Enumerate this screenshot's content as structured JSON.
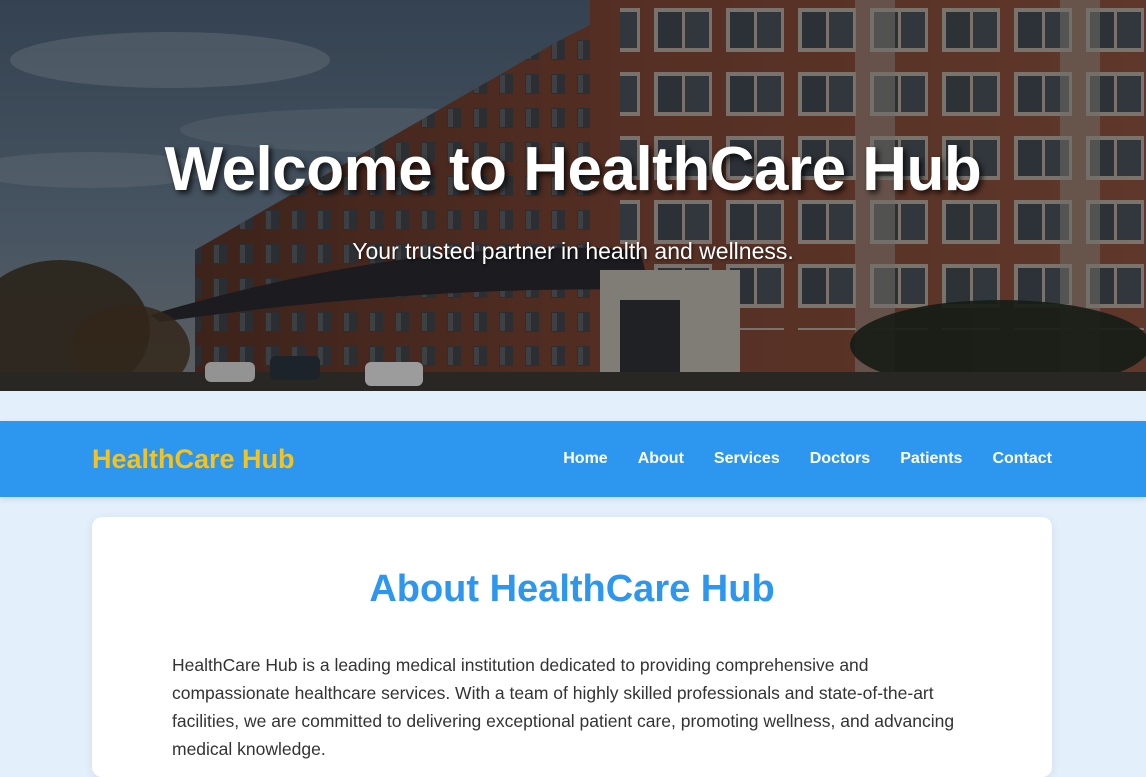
{
  "hero": {
    "title": "Welcome to HealthCare Hub",
    "subtitle": "Your trusted partner in health and wellness.",
    "image": "hospital-building-photo"
  },
  "navbar": {
    "brand": "HealthCare Hub",
    "links": [
      "Home",
      "About",
      "Services",
      "Doctors",
      "Patients",
      "Contact"
    ]
  },
  "about": {
    "heading": "About HealthCare Hub",
    "body": "HealthCare Hub is a leading medical institution dedicated to providing comprehensive and compassionate healthcare services. With a team of highly skilled professionals and state-of-the-art facilities, we are committed to delivering exceptional patient care, promoting wellness, and advancing medical knowledge."
  },
  "colors": {
    "accent": "#2d96ef",
    "brand": "#f7c21a",
    "background": "#e3f0fc",
    "card": "#ffffff",
    "text": "#333333"
  }
}
